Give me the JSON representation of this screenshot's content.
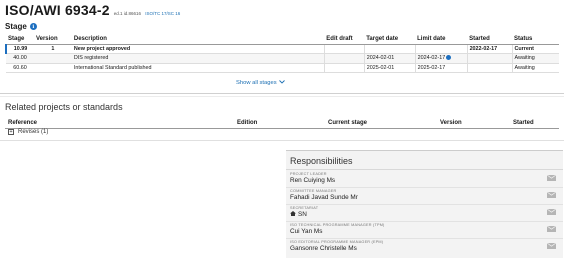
{
  "header": {
    "title": "ISO/AWI 6934-2",
    "meta": "ed.1 id.86616",
    "committee": "ISO/TC 17/SC 16"
  },
  "stage_section": {
    "label": "Stage",
    "columns": [
      "Stage",
      "Version",
      "Description",
      "Edit draft",
      "Target date",
      "Limit date",
      "Started",
      "Status"
    ],
    "rows": [
      {
        "stage": "10.99",
        "version": "1",
        "description": "New project approved",
        "edit_draft": "",
        "target_date": "",
        "limit_date": "",
        "started": "2022-02-17",
        "status": "Current"
      },
      {
        "stage": "40.00",
        "version": "",
        "description": "DIS registered",
        "edit_draft": "",
        "target_date": "2024-02-01",
        "limit_date": "2024-02-17",
        "started": "",
        "status": "Awaiting"
      },
      {
        "stage": "60.60",
        "version": "",
        "description": "International Standard published",
        "edit_draft": "",
        "target_date": "2025-02-01",
        "limit_date": "2025-02-17",
        "started": "",
        "status": "Awaiting"
      }
    ],
    "show_all": "Show all stages"
  },
  "related": {
    "title": "Related projects or standards",
    "columns": [
      "Reference",
      "Edition",
      "Current stage",
      "Version",
      "Started"
    ],
    "revises": "Revises (1)"
  },
  "responsibilities": {
    "title": "Responsibilities",
    "items": [
      {
        "role": "PROJECT LEADER",
        "name": "Ren Cuiying Ms"
      },
      {
        "role": "COMMITTEE MANAGER",
        "name": "Fahadi Javad Sunde Mr"
      },
      {
        "role": "SECRETARIAT",
        "name": "SN"
      },
      {
        "role": "ISO TECHNICAL PROGRAMME MANAGER (TPM)",
        "name": "Cui Yan Ms"
      },
      {
        "role": "ISO EDITORIAL PROGRAMME MANAGER (EPM)",
        "name": "Gansonre Christelle Ms"
      }
    ]
  },
  "colors": {
    "accent": "#1d6fc0",
    "link": "#1c6fb3",
    "panel": "#f3f3f3"
  }
}
